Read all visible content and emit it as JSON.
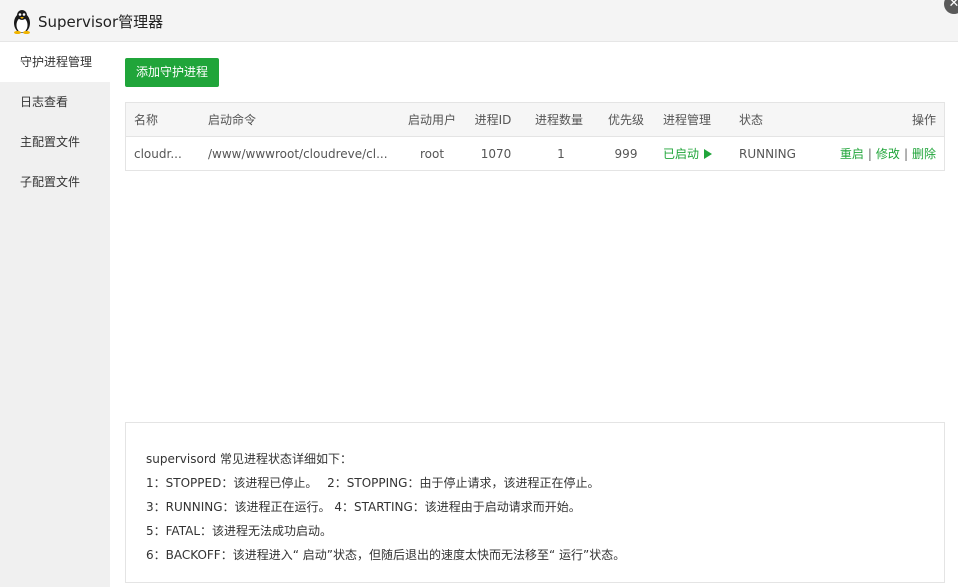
{
  "window": {
    "title": "Supervisor管理器",
    "icon": "linux-penguin-icon",
    "close_glyph": "✕"
  },
  "sidebar": {
    "items": [
      {
        "label": "守护进程管理",
        "active": true
      },
      {
        "label": "日志查看",
        "active": false
      },
      {
        "label": "主配置文件",
        "active": false
      },
      {
        "label": "子配置文件",
        "active": false
      }
    ]
  },
  "toolbar": {
    "add_label": "添加守护进程"
  },
  "table": {
    "headers": [
      "名称",
      "启动命令",
      "启动用户",
      "进程ID",
      "进程数量",
      "优先级",
      "进程管理",
      "状态",
      "操作"
    ],
    "rows": [
      {
        "name": "cloudr...",
        "command": "/www/wwwroot/cloudreve/cl...",
        "user": "root",
        "pid": "1070",
        "count": "1",
        "priority": "999",
        "manage": "已启动",
        "status": "RUNNING",
        "actions": [
          "重启",
          "修改",
          "删除"
        ]
      }
    ]
  },
  "info": {
    "lines": [
      "supervisord 常见进程状态详细如下：",
      "1：STOPPED：该进程已停止。　  2：STOPPING：由于停止请求，该进程正在停止。",
      "3：RUNNING：该进程正在运行。 4：STARTING：该进程由于启动请求而开始。",
      "5：FATAL：该进程无法成功启动。",
      "6：BACKOFF：该进程进入“ 启动”状态，但随后退出的速度太快而无法移至“ 运行”状态。"
    ]
  },
  "colors": {
    "accent": "#20a53a",
    "sidebar_bg": "#f0f0f0",
    "titlebar_bg": "#f4f4f4"
  }
}
